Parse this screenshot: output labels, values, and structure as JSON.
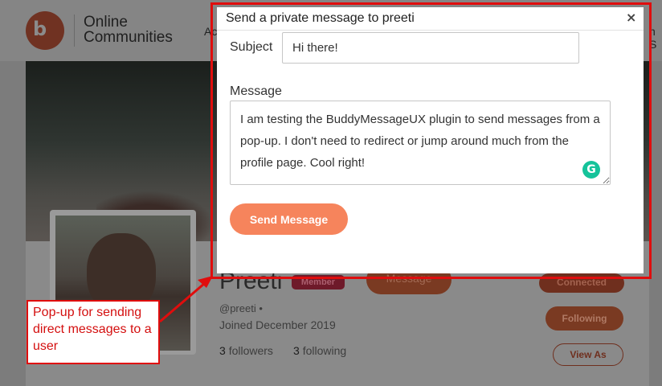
{
  "header": {
    "brand_line1": "Online",
    "brand_line2": "Communities",
    "nav_left": "Ac",
    "nav_right": "n S",
    "logo_icon": "buddyboss-logo-icon"
  },
  "profile": {
    "name": "Preeti",
    "badge": "Member",
    "handle": "@preeti •",
    "joined": "Joined December 2019",
    "followers_count": "3",
    "followers_label": "followers",
    "following_count": "3",
    "following_label": "following",
    "message_button": "Message",
    "connected_button": "Connected",
    "following_button": "Following",
    "view_as_button": "View As"
  },
  "modal": {
    "title": "Send a private message to preeti",
    "close": "×",
    "subject_label": "Subject",
    "subject_value": "Hi there!",
    "message_label": "Message",
    "message_value": "I am testing the BuddyMessageUX plugin to send messages from a pop-up. I don't need to redirect or jump around much from the profile page. Cool right!",
    "grammarly_icon": "grammarly-icon",
    "grammarly_glyph": "G",
    "send_button": "Send Message"
  },
  "annotation": {
    "callout_text": "Pop-up for sending direct messages to a user",
    "frame_color": "#e00d0d"
  },
  "colors": {
    "accent": "#f6845c",
    "grammarly": "#15c39a"
  }
}
